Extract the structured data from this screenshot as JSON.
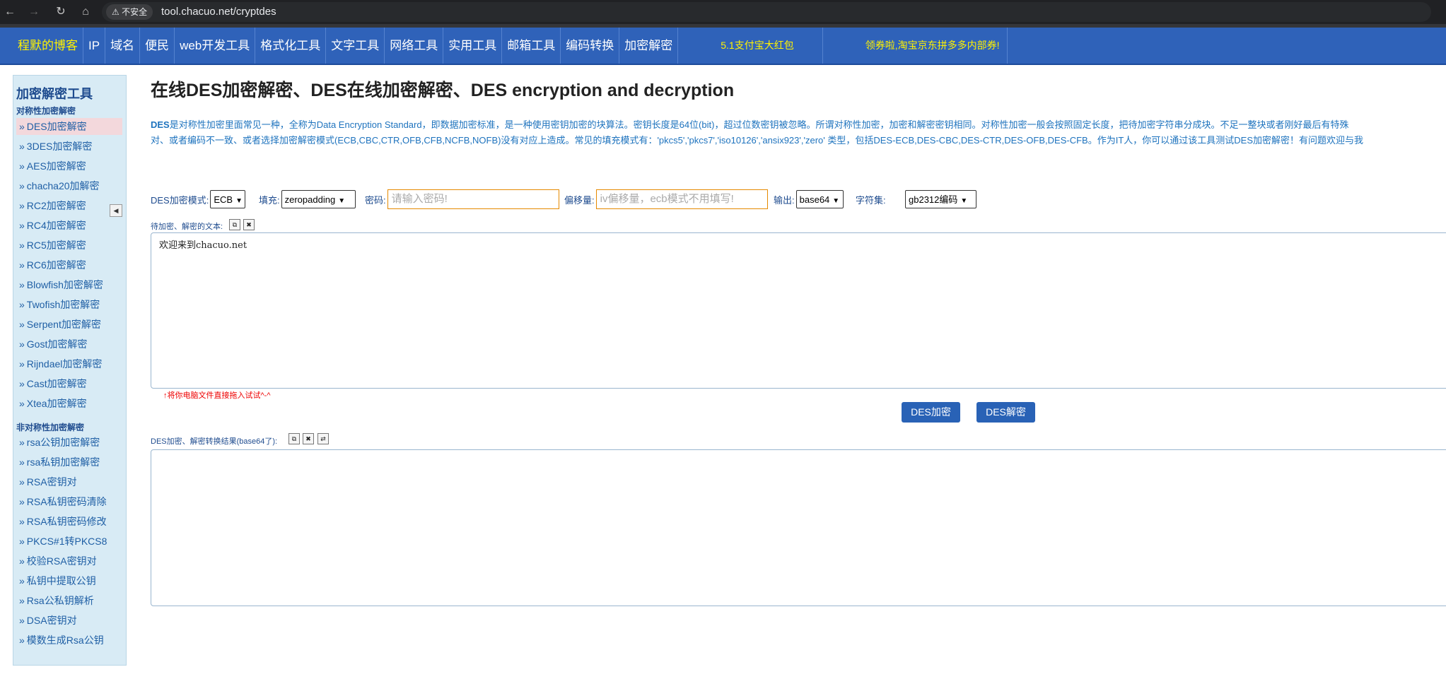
{
  "browser": {
    "security_label": "不安全",
    "url": "tool.chacuo.net/cryptdes"
  },
  "topnav": {
    "items": [
      "程默的博客",
      "IP",
      "域名",
      "便民",
      "web开发工具",
      "格式化工具",
      "文字工具",
      "网络工具",
      "实用工具",
      "邮箱工具",
      "编码转换",
      "加密解密"
    ],
    "promo1": "5.1支付宝大红包",
    "promo2": "领券啦,淘宝京东拼多多内部券!"
  },
  "sidebar": {
    "title": "加密解密工具",
    "section1": "对称性加密解密",
    "section1_items": [
      "DES加密解密",
      "3DES加密解密",
      "AES加密解密",
      "chacha20加解密",
      "RC2加密解密",
      "RC4加密解密",
      "RC5加密解密",
      "RC6加密解密",
      "Blowfish加密解密",
      "Twofish加密解密",
      "Serpent加密解密",
      "Gost加密解密",
      "Rijndael加密解密",
      "Cast加密解密",
      "Xtea加密解密"
    ],
    "section2": "非对称性加密解密",
    "section2_items": [
      "rsa公钥加密解密",
      "rsa私钥加密解密",
      "RSA密钥对",
      "RSA私钥密码清除",
      "RSA私钥密码修改",
      "PKCS#1转PKCS8",
      "校验RSA密钥对",
      "私钥中提取公钥",
      "Rsa公私钥解析",
      "DSA密钥对",
      "模数生成Rsa公钥"
    ]
  },
  "main": {
    "title": "在线DES加密解密、DES在线加密解密、DES encryption and decryption",
    "desc_bold": "DES",
    "desc_line1": "是对称性加密里面常见一种，全称为Data Encryption Standard，即数据加密标准，是一种使用密钥加密的块算法。密钥长度是64位(bit)，超过位数密钥被忽略。所谓对称性加密，加密和解密密钥相同。对称性加密一般会按照固定长度，把待加密字符串分成块。不足一整块或者刚好最后有特殊",
    "desc_line2": "对、或者编码不一致、或者选择加密解密模式(ECB,CBC,CTR,OFB,CFB,NCFB,NOFB)没有对应上造成。常见的填充模式有：'pkcs5','pkcs7','iso10126','ansix923','zero' 类型，包括DES-ECB,DES-CBC,DES-CTR,DES-OFB,DES-CFB。作为IT人，你可以通过该工具测试DES加密解密！有问题欢迎与我",
    "mode_label": "DES加密模式:",
    "mode_value": "ECB",
    "pad_label": "填充:",
    "pad_value": "zeropadding",
    "key_label": "密码:",
    "key_placeholder": "请输入密码!",
    "iv_label": "偏移量:",
    "iv_placeholder": "iv偏移量，ecb模式不用填写!",
    "out_label": "输出:",
    "out_value": "base64",
    "charset_label": "字符集:",
    "charset_value": "gb2312编码",
    "input_label": "待加密、解密的文本:",
    "input_text": "欢迎来到chacuo.net",
    "drop_hint": "↑将你电脑文件直接拖入试试^-^",
    "encrypt_btn": "DES加密",
    "decrypt_btn": "DES解密",
    "result_label": "DES加密、解密转换结果(base64了):",
    "result_text": ""
  },
  "colors": {
    "nav_bg": "#2f62b9",
    "button_bg": "#2962b6",
    "sidebar_bg": "#d8ebf5",
    "link": "#1e73be"
  }
}
